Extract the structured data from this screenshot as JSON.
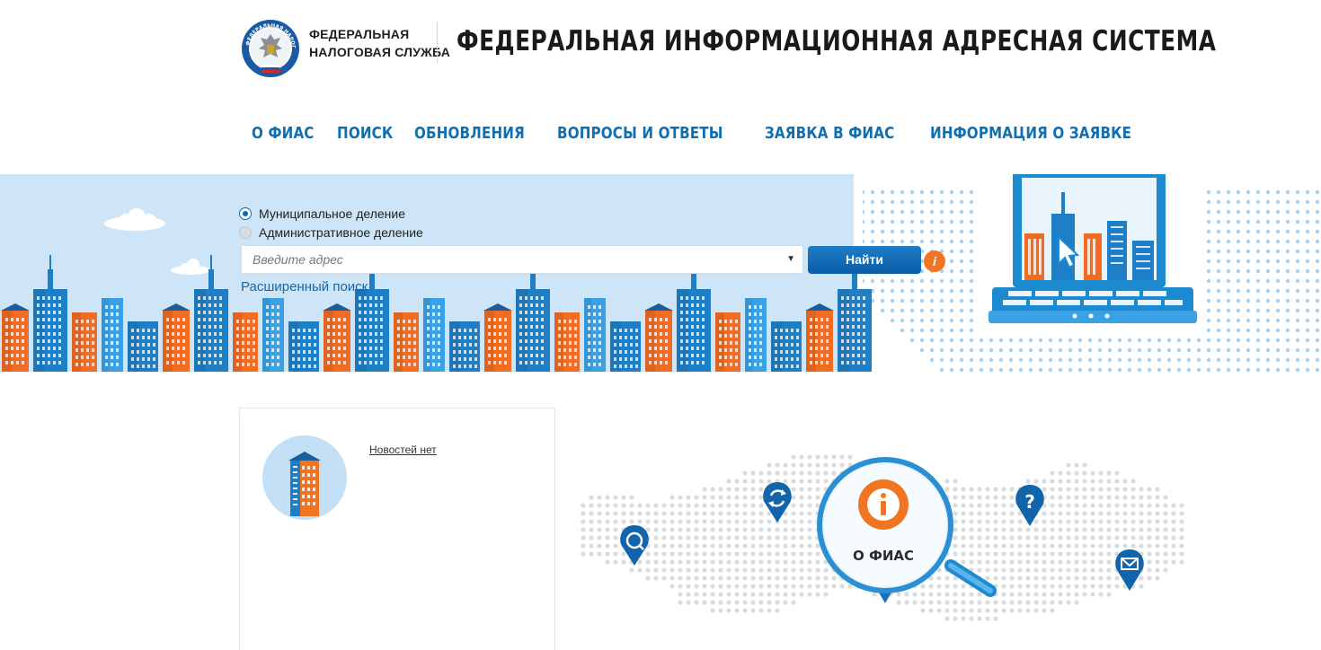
{
  "header": {
    "org_line1": "Федеральная",
    "org_line2": "налоговая служба",
    "logo_text": "ФЕДЕРАЛЬНАЯ НАЛОГОВАЯ СЛУЖБА",
    "site_title": "ФЕДЕРАЛЬНАЯ ИНФОРМАЦИОННАЯ АДРЕСНАЯ СИСТЕМА"
  },
  "nav": {
    "items": [
      {
        "label": "О ФИАС"
      },
      {
        "label": "ПОИСК"
      },
      {
        "label": "ОБНОВЛЕНИЯ"
      },
      {
        "label": "ВОПРОСЫ И ОТВЕТЫ"
      },
      {
        "label": "ЗАЯВКА В ФИАС"
      },
      {
        "label": "ИНФОРМАЦИЯ О ЗАЯВКЕ"
      }
    ]
  },
  "search": {
    "division_options": [
      {
        "label": "Муниципальное деление",
        "selected": true
      },
      {
        "label": "Административное деление",
        "selected": false
      }
    ],
    "address_placeholder": "Введите адрес",
    "find_label": "Найти",
    "info_label": "i",
    "advanced_label": "Расширенный поиск"
  },
  "news": {
    "empty_label": "Новостей нет"
  },
  "map": {
    "center_label": "О ФИАС",
    "center_icon": "info-icon",
    "pins": [
      "search-icon",
      "refresh-icon",
      "question-icon",
      "mail-icon"
    ]
  },
  "colors": {
    "brand_blue": "#0f6fb3",
    "accent_orange": "#f07522",
    "banner_bg": "#cde5f6"
  }
}
